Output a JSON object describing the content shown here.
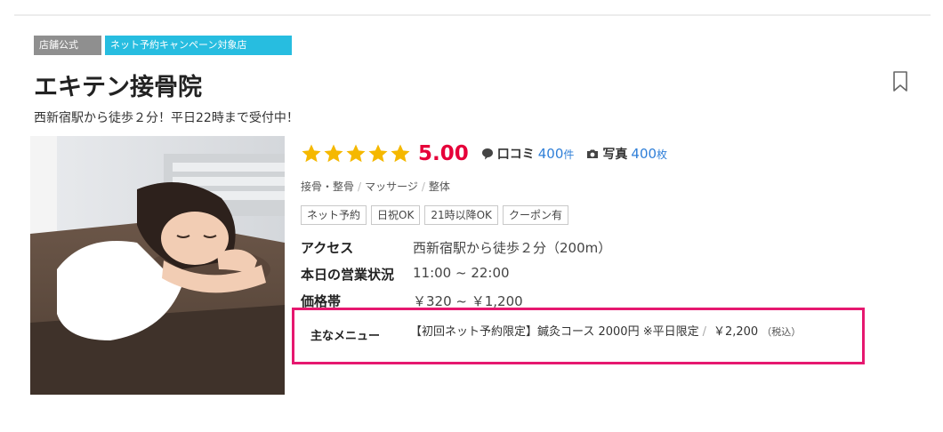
{
  "shop": {
    "badges": {
      "official": "店舗公式",
      "campaign": "ネット予約キャンペーン対象店"
    },
    "name": "エキテン接骨院",
    "catch_copy": "西新宿駅から徒歩２分！平日22時まで受付中！",
    "bookmark_icon": "bookmark-icon"
  },
  "rating": {
    "stars": 5,
    "score": "5.00",
    "reviews": {
      "label": "口コミ",
      "count": "400",
      "unit": "件",
      "icon": "speech-bubble-icon"
    },
    "photos": {
      "label": "写真",
      "count": "400",
      "unit": "枚",
      "icon": "camera-icon"
    }
  },
  "genres": [
    "接骨・整骨",
    "マッサージ",
    "整体"
  ],
  "tags": [
    "ネット予約",
    "日祝OK",
    "21時以降OK",
    "クーポン有"
  ],
  "info": {
    "access": {
      "label": "アクセス",
      "value": "西新宿駅から徒歩２分（200m）"
    },
    "hours": {
      "label": "本日の営業状況",
      "value": "11:00 ~ 22:00"
    },
    "price": {
      "label": "価格帯",
      "value": "￥320 ~ ￥1,200"
    }
  },
  "menu": {
    "label": "主なメニュー",
    "item": "【初回ネット予約限定】鍼灸コース 2000円 ※平日限定",
    "price": "￥2,200",
    "tax": "（税込）"
  },
  "colors": {
    "star": "#f5b800",
    "score": "#e60039",
    "link": "#2f7fd8",
    "highlight": "#e6186f",
    "campaign_badge": "#27bde0"
  }
}
